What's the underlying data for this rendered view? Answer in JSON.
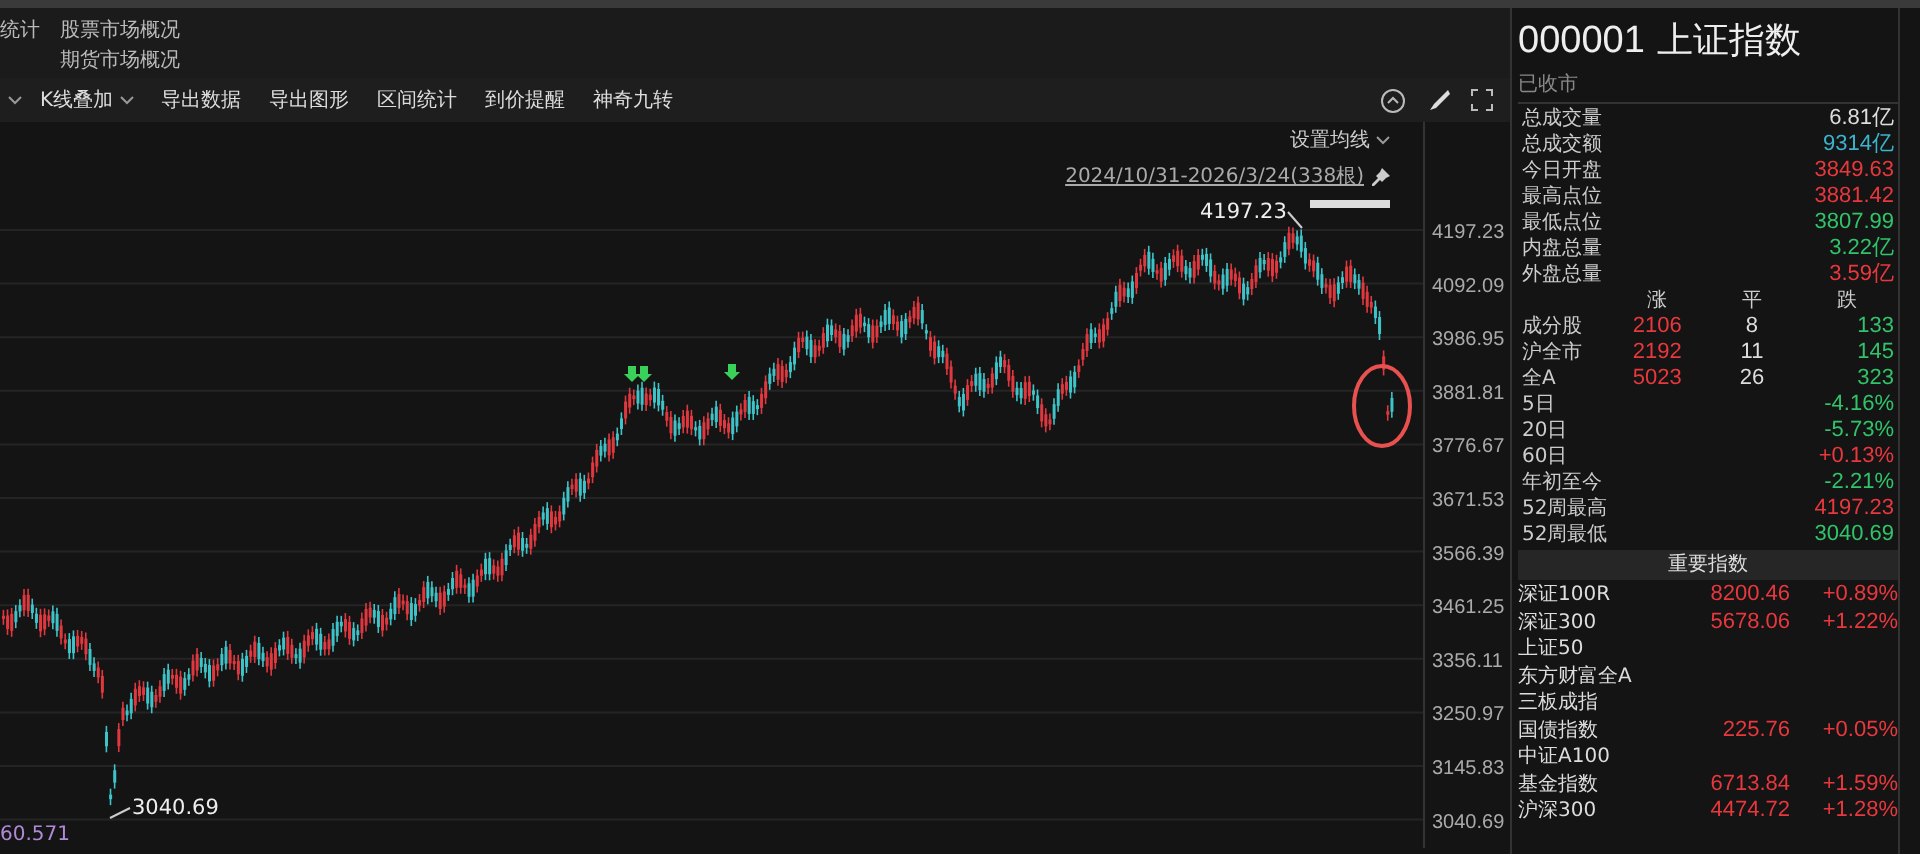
{
  "quick_links": [
    {
      "cut_label": "统计",
      "label": "股票市场概况"
    },
    {
      "label": "期货市场概况"
    }
  ],
  "toolbar": {
    "items": [
      {
        "label": "K线叠加",
        "dropdown": true
      },
      {
        "label": "导出数据",
        "dropdown": false
      },
      {
        "label": "导出图形",
        "dropdown": false
      },
      {
        "label": "区间统计",
        "dropdown": false
      },
      {
        "label": "到价提醒",
        "dropdown": false
      },
      {
        "label": "神奇九转",
        "dropdown": false
      }
    ]
  },
  "chart": {
    "ma_setting": "设置均线",
    "range": "2024/10/31-2026/3/24(338根)",
    "y_ticks": [
      "4197.23",
      "4092.09",
      "3986.95",
      "3881.81",
      "3776.67",
      "3671.53",
      "3566.39",
      "3461.25",
      "3356.11",
      "3250.97",
      "3145.83",
      "3040.69"
    ],
    "high_label": "4197.23",
    "low_label": "3040.69",
    "indicator_value": "60.571"
  },
  "quote": {
    "code": "000001",
    "name": "上证指数",
    "status": "已收市",
    "stats": [
      {
        "label": "总成交量",
        "value": "6.81亿",
        "color": "#dddddd"
      },
      {
        "label": "总成交额",
        "value": "9314亿",
        "color": "#3bb3cc"
      },
      {
        "label": "今日开盘",
        "value": "3849.63",
        "color": "#e8383d"
      },
      {
        "label": "最高点位",
        "value": "3881.42",
        "color": "#e8383d"
      },
      {
        "label": "最低点位",
        "value": "3807.99",
        "color": "#32c36a"
      },
      {
        "label": "内盘总量",
        "value": "3.22亿",
        "color": "#32c36a"
      },
      {
        "label": "外盘总量",
        "value": "3.59亿",
        "color": "#e8383d"
      }
    ],
    "breadth": {
      "headers": [
        "涨",
        "平",
        "跌"
      ],
      "rows": [
        {
          "label": "成分股",
          "up": "2106",
          "flat": "8",
          "down": "133"
        },
        {
          "label": "沪全市",
          "up": "2192",
          "flat": "11",
          "down": "145"
        },
        {
          "label": "全A",
          "up": "5023",
          "flat": "26",
          "down": "323"
        }
      ]
    },
    "performance": [
      {
        "label": "5日",
        "value": "-4.16%",
        "color": "#32c36a"
      },
      {
        "label": "20日",
        "value": "-5.73%",
        "color": "#32c36a"
      },
      {
        "label": "60日",
        "value": "+0.13%",
        "color": "#e8383d"
      },
      {
        "label": "年初至今",
        "value": "-2.21%",
        "color": "#32c36a"
      },
      {
        "label": "52周最高",
        "value": "4197.23",
        "color": "#e8383d"
      },
      {
        "label": "52周最低",
        "value": "3040.69",
        "color": "#32c36a"
      }
    ]
  },
  "key_indices": {
    "title": "重要指数",
    "rows": [
      {
        "name": "深证100R",
        "value": "8200.46",
        "change": "+0.89%"
      },
      {
        "name": "深证300",
        "value": "5678.06",
        "change": "+1.22%"
      },
      {
        "name": "上证50"
      },
      {
        "name": "东方财富全A"
      },
      {
        "name": "三板成指"
      },
      {
        "name": "国债指数",
        "value": "225.76",
        "change": "+0.05%"
      },
      {
        "name": "中证A100"
      },
      {
        "name": "基金指数",
        "value": "6713.84",
        "change": "+1.59%"
      },
      {
        "name": "沪深300",
        "value": "4474.72",
        "change": "+1.28%"
      }
    ]
  }
}
